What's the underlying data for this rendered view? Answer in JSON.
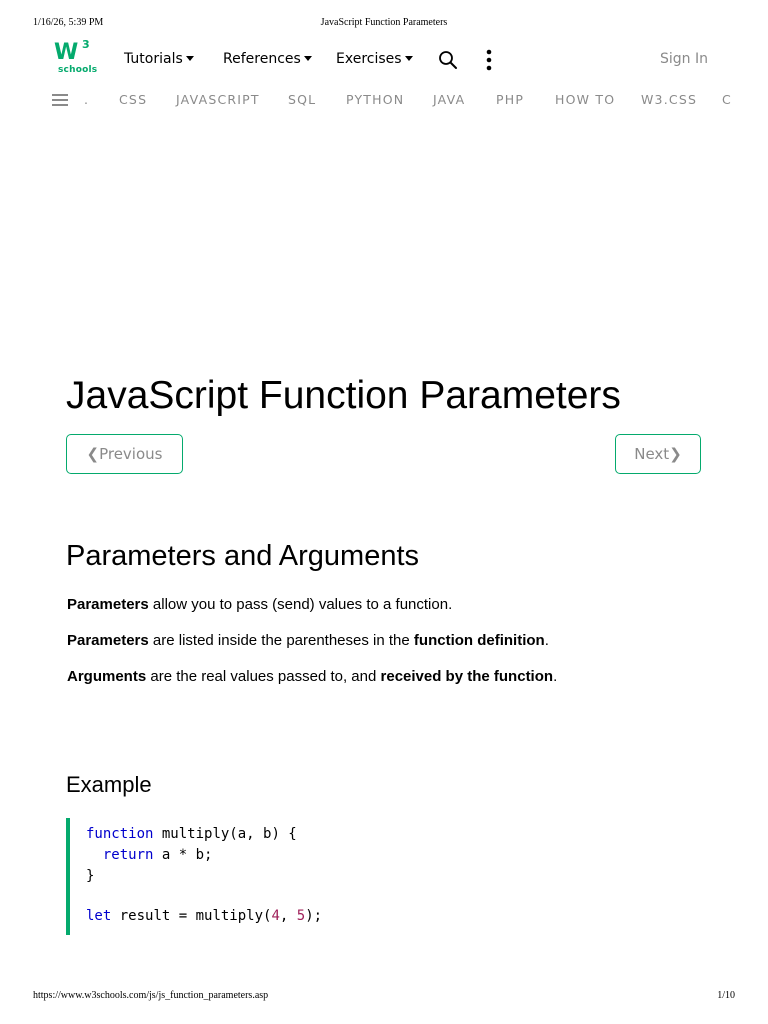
{
  "print_header": {
    "datetime": "1/16/26, 5:39 PM",
    "title": "JavaScript Function Parameters"
  },
  "print_footer": {
    "url": "https://www.w3schools.com/js/js_function_parameters.asp",
    "page": "1/10"
  },
  "topnav": {
    "logo_w": "W",
    "logo_3": "3",
    "logo_schools": "schools",
    "tutorials": "Tutorials",
    "references": "References",
    "exercises": "Exercises",
    "sign_in": "Sign In",
    "icons": [
      "search-icon",
      "more-vertical-icon",
      "caret-down-icon"
    ]
  },
  "subnav": {
    "items": [
      ".",
      "CSS",
      "JAVASCRIPT",
      "SQL",
      "PYTHON",
      "JAVA",
      "PHP",
      "HOW TO",
      "W3.CSS",
      "C"
    ]
  },
  "main": {
    "title": "JavaScript Function Parameters",
    "prev_label": "Previous",
    "next_label": "Next",
    "prev_chevron": "❮",
    "next_chevron": "❯",
    "section_title": "Parameters and Arguments",
    "p1": {
      "b1": "Parameters",
      "t1": " allow you to pass (send) values to a function."
    },
    "p2": {
      "b1": "Parameters",
      "t1": " are listed inside the parentheses in the ",
      "b2": "function definition",
      "t2": "."
    },
    "p3": {
      "b1": "Arguments",
      "t1": " are the real values passed to, and ",
      "b2": "received by the function",
      "t2": "."
    },
    "example_title": "Example",
    "code": {
      "l1_kw": "function",
      "l1_rest": " multiply(a, b) {",
      "l2_indent": "  ",
      "l2_kw": "return",
      "l2_rest": " a * b;",
      "l3": "}",
      "l4_kw": "let",
      "l4_a": " result = multiply(",
      "l4_n1": "4",
      "l4_b": ", ",
      "l4_n2": "5",
      "l4_c": ");"
    }
  },
  "colors": {
    "accent": "#04AA6D",
    "muted": "#8a8a8a",
    "keyword": "#0000cd",
    "number": "#a0205a"
  }
}
